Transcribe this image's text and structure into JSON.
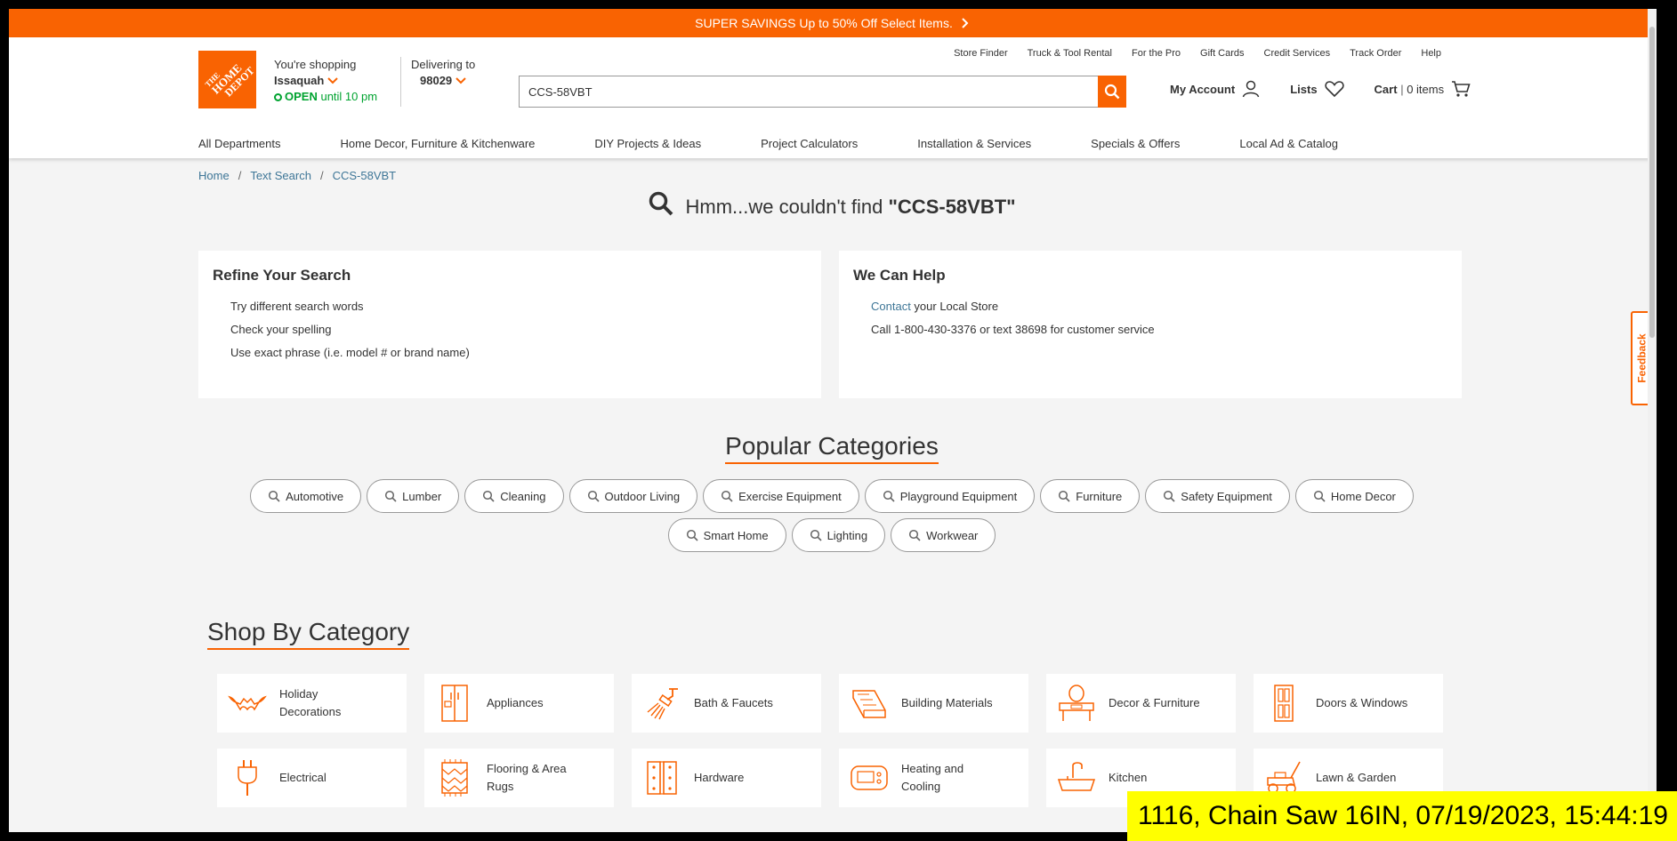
{
  "banner": {
    "text": "SUPER SAVINGS Up to 50% Off Select Items.",
    "icon": "chevron-right-icon"
  },
  "logo": {
    "text": "THE HOME DEPOT"
  },
  "store": {
    "line1": "You're shopping",
    "name": "Issaquah",
    "open": "OPEN",
    "hours": "until 10 pm"
  },
  "delivery": {
    "label": "Delivering to",
    "zip": "98029"
  },
  "utility_nav": [
    "Store Finder",
    "Truck & Tool Rental",
    "For the Pro",
    "Gift Cards",
    "Credit Services",
    "Track Order",
    "Help"
  ],
  "search": {
    "value": "CCS-58VBT"
  },
  "account": {
    "my_account": "My Account",
    "lists": "Lists",
    "cart": "Cart",
    "cart_count": "0 items"
  },
  "main_nav": [
    "All Departments",
    "Home Decor, Furniture & Kitchenware",
    "DIY Projects & Ideas",
    "Project Calculators",
    "Installation & Services",
    "Specials & Offers",
    "Local Ad & Catalog"
  ],
  "breadcrumb": [
    "Home",
    "Text Search",
    "CCS-58VBT"
  ],
  "no_results": {
    "prefix": "Hmm...we couldn't find",
    "query": "\"CCS-58VBT\""
  },
  "refine": {
    "title": "Refine Your Search",
    "items": [
      "Try different search words",
      "Check your spelling",
      "Use exact phrase (i.e. model # or brand name)"
    ]
  },
  "help": {
    "title": "We Can Help",
    "contact_link": "Contact",
    "contact_rest": " your Local Store",
    "phone": "Call 1-800-430-3376 or text 38698 for customer service"
  },
  "popular": {
    "title": "Popular Categories",
    "chips": [
      "Automotive",
      "Lumber",
      "Cleaning",
      "Outdoor Living",
      "Exercise Equipment",
      "Playground Equipment",
      "Furniture",
      "Safety Equipment",
      "Home Decor",
      "Smart Home",
      "Lighting",
      "Workwear"
    ]
  },
  "shop": {
    "title": "Shop By Category",
    "tiles": [
      {
        "label": "Holiday Decorations",
        "icon": "bat-icon"
      },
      {
        "label": "Appliances",
        "icon": "refrigerator-icon"
      },
      {
        "label": "Bath & Faucets",
        "icon": "shower-icon"
      },
      {
        "label": "Building Materials",
        "icon": "lumber-icon"
      },
      {
        "label": "Decor & Furniture",
        "icon": "vanity-icon"
      },
      {
        "label": "Doors & Windows",
        "icon": "door-icon"
      },
      {
        "label": "Electrical",
        "icon": "plug-icon"
      },
      {
        "label": "Flooring & Area Rugs",
        "icon": "rug-icon"
      },
      {
        "label": "Hardware",
        "icon": "hinge-icon"
      },
      {
        "label": "Heating and Cooling",
        "icon": "thermostat-icon"
      },
      {
        "label": "Kitchen",
        "icon": "sink-icon"
      },
      {
        "label": "Lawn & Garden",
        "icon": "lawnmower-icon"
      }
    ]
  },
  "feedback": {
    "label": "Feedback"
  },
  "caption": {
    "text": "1116, Chain Saw   16IN, 07/19/2023, 15:44:19"
  },
  "colors": {
    "brand": "#f96302",
    "link": "#3e7697",
    "open": "#00a330",
    "caption_bg": "#ffff00"
  }
}
